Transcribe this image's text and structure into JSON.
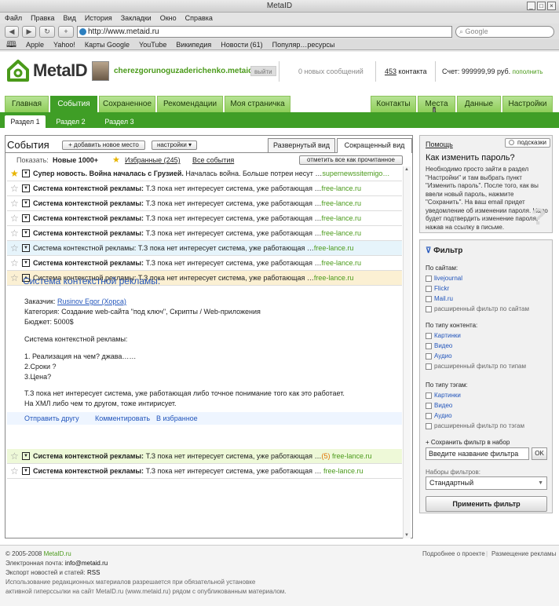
{
  "window": {
    "title": "MetaID",
    "controls": [
      "_",
      "□",
      "×"
    ]
  },
  "menu": [
    "Файл",
    "Правка",
    "Вид",
    "История",
    "Закладки",
    "Окно",
    "Справка"
  ],
  "toolbar": {
    "back": "◀",
    "forward": "▶",
    "reload": "↻",
    "add": "+",
    "url": "http://www.metaid.ru",
    "search_placeholder": "Google"
  },
  "bookmarks": [
    "Apple",
    "Yahoo!",
    "Карты Google",
    "YouTube",
    "Википедия",
    "Новости (61)",
    "Популяр…ресурсы"
  ],
  "header": {
    "logo": "MetaID",
    "username": "cherezgorunoguzaderichenko.metaid.ru",
    "exit": "выйти",
    "new_messages": "0 новых сообщений",
    "contacts_count": "453",
    "contacts_label": " контакта",
    "account": "Счет: 999999,99 руб.",
    "topup": "пополнить"
  },
  "tabs_left": [
    "Главная",
    "События",
    "Сохраненное",
    "Рекомендации",
    "Моя страничка"
  ],
  "tabs_right": [
    "Контакты",
    "Места",
    "Данные",
    "Настройки"
  ],
  "subtabs": [
    "Раздел 1",
    "Раздел 2",
    "Раздел 3"
  ],
  "events": {
    "title": "События",
    "add_button": "+ добавить новое место",
    "settings_button": "настройки ▾",
    "view_full": "Развернутый вид",
    "view_short": "Сокращенный вид",
    "show_label": "Показать:",
    "filter_new": "Новые 1000+",
    "filter_fav": "Избранные (245)",
    "filter_all": "Все события",
    "mark_all": "отметить все как прочитанное"
  },
  "rows": [
    {
      "title": "Супер новость. Война началась с Грузией.",
      "text": " Началась война. Больше потреи несут …",
      "src": "supernewssitemigo…",
      "starred": true
    },
    {
      "title": "Система контекстной рекламы:",
      "text": " Т.З пока нет интересует система, уже работающая …",
      "src": "free-lance.ru",
      "starred": false
    },
    {
      "title": "Система контекстной рекламы:",
      "text": " Т.З пока нет интересует система, уже работающая …",
      "src": "free-lance.ru",
      "starred": false
    },
    {
      "title": "Система контекстной рекламы:",
      "text": " Т.З пока нет интересует система, уже работающая …",
      "src": "free-lance.ru",
      "starred": false
    },
    {
      "title": "Система контекстной рекламы:",
      "text": " Т.З пока нет интересует система, уже работающая …",
      "src": "free-lance.ru",
      "starred": false
    },
    {
      "title": "Система контекстной рекламы:",
      "text": " Т.З пока нет интересует система, уже работающая …",
      "src": "free-lance.ru",
      "starred": false
    },
    {
      "title": "Система контекстной рекламы:",
      "text": " Т.З пока нет интересует система, уже работающая …",
      "src": "free-lance.ru",
      "starred": false
    },
    {
      "title": "Система контекстной рекламы:",
      "text": " Т.З пока нет интересует система, уже работающая …",
      "src": "free-lance.ru",
      "starred": false
    }
  ],
  "expanded": {
    "heading": "Система контекстной рекламы:",
    "customer_label": "Заказчик: ",
    "customer": "Rusinov Egor (Хорса)",
    "category": "Категория: Создание web-сайта \"под ключ\", Скрипты / Web-приложения",
    "budget": "Бюджет: 5000$",
    "line1": "Система контекстной рекламы:",
    "line2": "1. Реализация на чем? джава……",
    "line3": "2.Сроки ?",
    "line4": "3.Цена?",
    "line5": "Т.З пока нет интересует система, уже работающая либо точное понимание того как это работает.",
    "line6": "На ХМЛ либо чем то другом, тоже интирисует.",
    "action_send": "Отправить другу",
    "action_comment": "Комментировать",
    "action_fav": "В избранное"
  },
  "rows_after": [
    {
      "title": "Система контекстной рекламы:",
      "text": " Т.З пока нет интересует система, уже работающая …",
      "count": "(5)",
      "src": "free-lance.ru"
    },
    {
      "title": "Система контекстной рекламы:",
      "text": " Т.З пока нет интересует система, уже работающая …",
      "count": "",
      "src": "free-lance.ru"
    }
  ],
  "help": {
    "link": "Помощь",
    "hints": "подсказки",
    "question": "Как изменить пароль?",
    "answer1": "Необходимо просто зайти в раздел",
    "answer2": "\"Настройки\" и там выбрать пункт",
    "answer3": "\"Изменить пароль\". После того, как вы",
    "answer4": "ввели новый пароль, нажмите",
    "answer5": "\"Сохранить\". На ваш email придет",
    "answer6": "уведомление об изменении пароля. Надо",
    "answer7": "будет подтвердить изменение пароля,",
    "answer8": "нажав на ссылку в письме.",
    "qmark": "?"
  },
  "filter": {
    "title": "Фильтр",
    "by_sites": "По сайтам:",
    "sites": [
      "livejournal",
      "Flickr",
      "Mail.ru"
    ],
    "sites_ext": "расширенный фильтр по сайтам",
    "by_type": "По типу контента:",
    "types": [
      "Картинки",
      "Видео",
      "Аудио"
    ],
    "types_ext": "расширенный фильтр по типам",
    "by_tags": "По типу тэгам:",
    "tags": [
      "Картинки",
      "Видео",
      "Аудио"
    ],
    "tags_ext": "расширенный фильтр по тэгам",
    "save_label": "+ Сохранить фильтр в набор",
    "save_placeholder": "Введите название фильтра",
    "ok": "OK",
    "sets_label": "Наборы фильтров:",
    "sets_value": "Стандартный",
    "apply": "Применить фильтр"
  },
  "footer": {
    "copyright": "© 2005-2008 ",
    "copyright_link": "MetaID.ru",
    "email_label": "Электронная почта: ",
    "email": "info@metaid.ru",
    "export_label": "Экспорт новостей и статей: ",
    "export": "RSS",
    "notice1": "Использование редакционных материалов разрешается при обязательной установке",
    "notice2": "активной гиперссылки на сайт MetaID.ru (www.metaid.ru) рядом с опубликованным материалом.",
    "about": "Подробнее о проекте",
    "ads": "Размещение рекламы"
  },
  "colors": {
    "brand_green": "#3f9e26",
    "tab_green": "#a6db7c",
    "link_blue": "#2255bb",
    "source_green": "#4a9a1a"
  }
}
